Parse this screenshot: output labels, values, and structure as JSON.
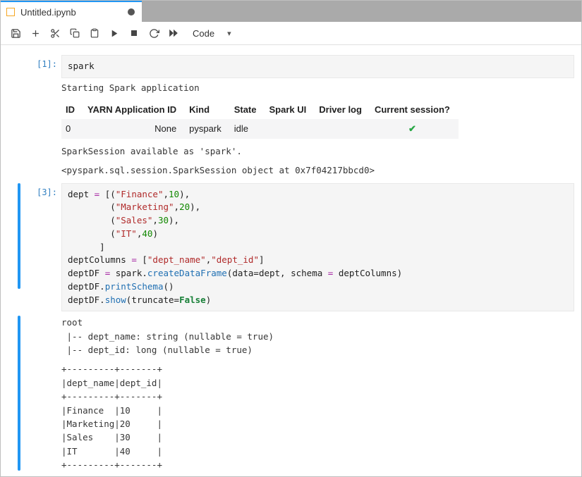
{
  "tab": {
    "title": "Untitled.ipynb",
    "dirty": true
  },
  "toolbar": {
    "save": "save-icon",
    "add": "add-icon",
    "cut": "cut-icon",
    "copy": "copy-icon",
    "paste": "paste-icon",
    "run": "run-icon",
    "stop": "stop-icon",
    "restart": "restart-icon",
    "runall": "runall-icon",
    "celltype_label": "Code"
  },
  "cells": {
    "c1": {
      "prompt": "[1]:",
      "code_plain": "spark",
      "out_start": "Starting Spark application",
      "table": {
        "headers": [
          "ID",
          "YARN Application ID",
          "Kind",
          "State",
          "Spark UI",
          "Driver log",
          "Current session?"
        ],
        "row": {
          "id": "0",
          "yarn": "None",
          "kind": "pyspark",
          "state": "idle",
          "sparkui": "",
          "driverlog": "",
          "current": "✔"
        }
      },
      "out_avail": "SparkSession available as 'spark'.",
      "out_repr": "<pyspark.sql.session.SparkSession object at 0x7f04217bbcd0>"
    },
    "c3": {
      "prompt": "[3]:",
      "code_plain": "dept = [(\"Finance\",10),\n        (\"Marketing\",20),\n        (\"Sales\",30),\n        (\"IT\",40)\n      ]\ndeptColumns = [\"dept_name\",\"dept_id\"]\ndeptDF = spark.createDataFrame(data=dept, schema = deptColumns)\ndeptDF.printSchema()\ndeptDF.show(truncate=False)",
      "out_schema": "root\n |-- dept_name: string (nullable = true)\n |-- dept_id: long (nullable = true)\n",
      "out_table": "+---------+-------+\n|dept_name|dept_id|\n+---------+-------+\n|Finance  |10     |\n|Marketing|20     |\n|Sales    |30     |\n|IT       |40     |\n+---------+-------+"
    }
  }
}
